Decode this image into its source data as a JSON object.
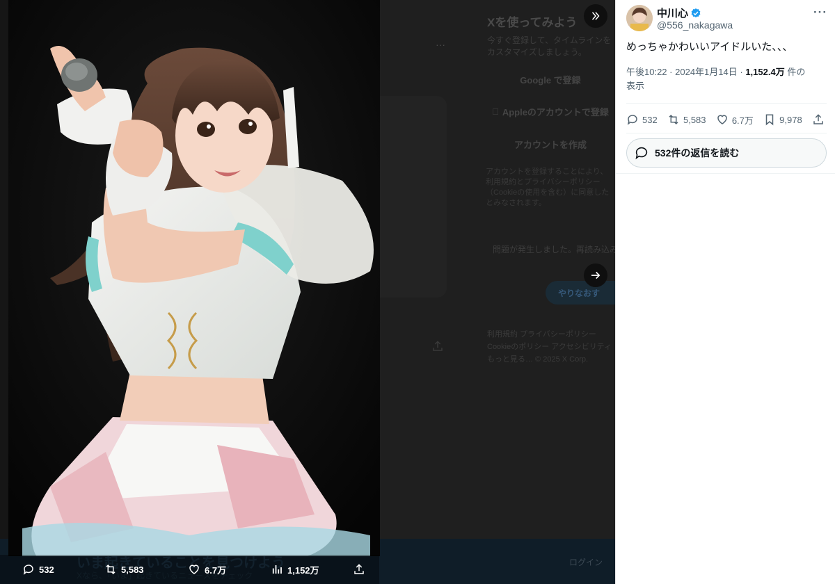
{
  "background": {
    "title": "Xを使ってみよう",
    "subtitle": "今すぐ登録して、タイムラインをカスタマイズしましょう。",
    "google_button": "Google で登録",
    "apple_button": "Appleのアカウントで登録",
    "create_account": "アカウントを作成",
    "terms": "アカウントを登録することにより、利用規約とプライバシーポリシー（Cookieの使用を含む）に同意したとみなされます。",
    "error": "問題が発生しました。再読み込みしてください。",
    "retry": "やりなおす",
    "footer_line1": "利用規約 プライバシーポリシー",
    "footer_line2": "Cookieのポリシー アクセシビリティ",
    "footer_line3": "もっと見る… © 2025 X Corp.",
    "login": "ログイン",
    "bottom_banner": "いま起きていることを見つけよう",
    "bottom_banner_sub": "Xなら、「いま」起きているニュースをチェック"
  },
  "media_actions": {
    "replies": "532",
    "retweets": "5,583",
    "likes": "6.7万",
    "views": "1,152万"
  },
  "tweet": {
    "display_name": "中川心",
    "handle": "@556_nakagawa",
    "text": "めっちゃかわいいアイドルいた、、、",
    "time": "午後10:22",
    "date": "2024年1月14日",
    "views": "1,152.4万",
    "views_suffix": "件の",
    "views_label": "表示",
    "replies": "532",
    "retweets": "5,583",
    "likes": "6.7万",
    "bookmarks": "9,978",
    "read_replies": "532件の返信を読む"
  },
  "colors": {
    "verified": "#1d9bf0",
    "text_primary": "#0f1419",
    "text_secondary": "#536471"
  },
  "icons": [
    "collapse-icon",
    "next-arrow-icon",
    "reply-icon",
    "retweet-icon",
    "like-icon",
    "views-icon",
    "share-icon",
    "bookmark-icon",
    "verified-badge-icon",
    "more-icon",
    "apple-icon"
  ]
}
